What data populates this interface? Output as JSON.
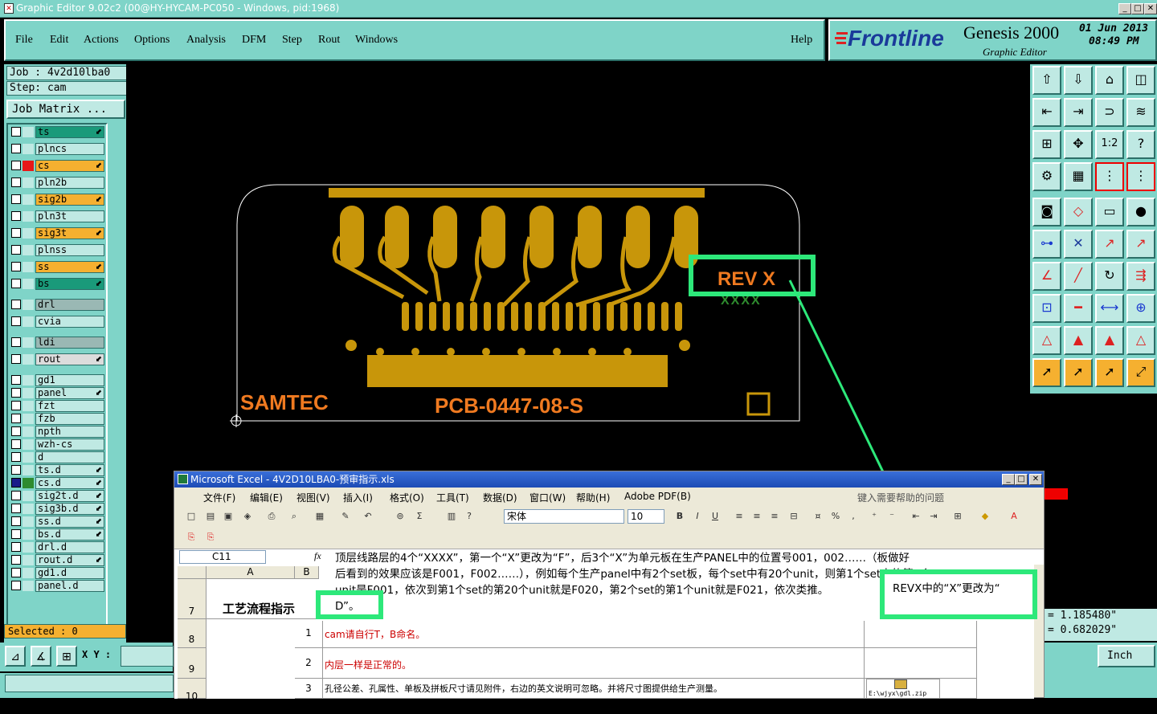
{
  "window": {
    "title": "Graphic Editor 9.02c2 (00@HY-HYCAM-PC050 - Windows, pid:1968)"
  },
  "menu": {
    "file": "File",
    "edit": "Edit",
    "actions": "Actions",
    "options": "Options",
    "analysis": "Analysis",
    "dfm": "DFM",
    "step": "Step",
    "rout": "Rout",
    "windows": "Windows",
    "help": "Help"
  },
  "brand": {
    "logo": "Frontline",
    "product": "Genesis 2000",
    "sub": "Graphic Editor",
    "date": "01  Jun  2013",
    "time": "08:49  PM"
  },
  "job": {
    "job_line": "Job : 4v2d10lba0",
    "step_line": "Step: cam",
    "matrix_button": "Job Matrix ..."
  },
  "layers": [
    {
      "name": "ts",
      "color": "#1a9a7a",
      "arrow": "⬋"
    },
    {
      "name": "plncs",
      "color": "#bfe9e3",
      "arrow": ""
    },
    {
      "name": "cs",
      "color": "#f5b030",
      "arrow": "⬋",
      "swatch": "#e81818"
    },
    {
      "name": "pln2b",
      "color": "#bfe9e3",
      "arrow": ""
    },
    {
      "name": "sig2b",
      "color": "#f5b030",
      "arrow": "⬋"
    },
    {
      "name": "pln3t",
      "color": "#bfe9e3",
      "arrow": ""
    },
    {
      "name": "sig3t",
      "color": "#f5b030",
      "arrow": "⬋"
    },
    {
      "name": "plnss",
      "color": "#bfe9e3",
      "arrow": ""
    },
    {
      "name": "ss",
      "color": "#f5b030",
      "arrow": "⬋"
    },
    {
      "name": "bs",
      "color": "#1a9a7a",
      "arrow": "⬋"
    },
    {
      "name": "drl",
      "color": "#9ab8b4",
      "arrow": ""
    },
    {
      "name": "cvia",
      "color": "#bfe9e3",
      "arrow": ""
    },
    {
      "name": "ldi",
      "color": "#9ab8b4",
      "arrow": ""
    },
    {
      "name": "rout",
      "color": "#dcdcdc",
      "arrow": "⬋"
    },
    {
      "name": "gd1",
      "color": "#bfe9e3",
      "arrow": ""
    },
    {
      "name": "panel",
      "color": "#bfe9e3",
      "arrow": "⬋"
    },
    {
      "name": "fzt",
      "color": "#bfe9e3",
      "arrow": ""
    },
    {
      "name": "fzb",
      "color": "#bfe9e3",
      "arrow": ""
    },
    {
      "name": "npth",
      "color": "#bfe9e3",
      "arrow": ""
    },
    {
      "name": "wzh-cs",
      "color": "#bfe9e3",
      "arrow": ""
    },
    {
      "name": "d",
      "color": "#bfe9e3",
      "arrow": ""
    },
    {
      "name": "ts.d",
      "color": "#bfe9e3",
      "arrow": "⬋"
    },
    {
      "name": "cs.d",
      "color": "#bfe9e3",
      "arrow": "⬋",
      "swatch": "#2e8b2e",
      "selected": true
    },
    {
      "name": "sig2t.d",
      "color": "#bfe9e3",
      "arrow": "⬋"
    },
    {
      "name": "sig3b.d",
      "color": "#bfe9e3",
      "arrow": "⬋"
    },
    {
      "name": "ss.d",
      "color": "#bfe9e3",
      "arrow": "⬋"
    },
    {
      "name": "bs.d",
      "color": "#bfe9e3",
      "arrow": "⬋"
    },
    {
      "name": "drl.d",
      "color": "#bfe9e3",
      "arrow": ""
    },
    {
      "name": "rout.d",
      "color": "#bfe9e3",
      "arrow": "⬋"
    },
    {
      "name": "gd1.d",
      "color": "#bfe9e3",
      "arrow": ""
    },
    {
      "name": "panel.d",
      "color": "#bfe9e3",
      "arrow": ""
    }
  ],
  "status": {
    "selected": "Selected : 0",
    "xy_label": "X Y :",
    "coord_x": "= 1.185480\"",
    "coord_y": "= 0.682029\"",
    "unit": "Inch"
  },
  "pcb": {
    "rev": "REV X",
    "xxxx": "XXXX",
    "samtec": "SAMTEC",
    "part": "PCB-0447-08-S"
  },
  "excel": {
    "title": "Microsoft Excel - 4V2D10LBA0-预审指示.xls",
    "menu": [
      "文件(F)",
      "编辑(E)",
      "视图(V)",
      "插入(I)",
      "格式(O)",
      "工具(T)",
      "数据(D)",
      "窗口(W)",
      "帮助(H)",
      "Adobe PDF(B)"
    ],
    "help_prompt": "键入需要帮助的问题",
    "font": "宋体",
    "size": "10",
    "cell_ref": "C11",
    "fx": "fx",
    "col_a": "A",
    "col_b": "B",
    "row7": "7",
    "row8": "8",
    "row9": "9",
    "row10": "10",
    "overlay_l1": "顶层线路层的4个“XXXX”，第一个“X”更改为“F”，后3个“X”为单元板在生产PANEL中的位置号001，002……（板做好",
    "overlay_l2": "后看到的效果应该是F001，F002……），例如每个生产panel中有2个set板，每个set中有20个unit，则第1个set中的第1个",
    "overlay_l3": "unit是F001，依次到第1个set的第20个unit就是F020，第2个set的第1个unit就是F021，依次类推。",
    "overlay_l4": "D”。",
    "rev_note": "REVX中的“X”更改为“",
    "a7": "工艺流程指示",
    "n1": "1",
    "n2": "2",
    "n3": "3",
    "r8": "cam请自行T，B命名。",
    "r9": "内层一样是正常的。",
    "r10": "孔径公差、孔属性、单板及拼板尺寸请见附件，右边的英文说明可忽略。并将尺寸图提供给生产测量。",
    "attachment": "E:\\wjyx\\gdl.zip"
  }
}
